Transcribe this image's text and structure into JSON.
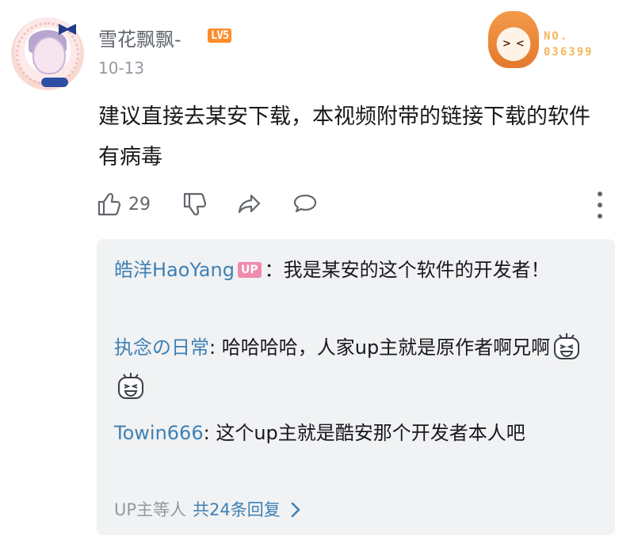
{
  "comment": {
    "username": "雪花飘飘-",
    "level_badge": "LV5",
    "date": "10-13",
    "text": "建议直接去某安下载，本视频附带的链接下载的软件有病毒",
    "like_count": "29"
  },
  "fan_card": {
    "label_no": "NO.",
    "number": "036399"
  },
  "replies": [
    {
      "name": "皓洋HaoYang",
      "badge": "UP",
      "sep": "：",
      "text": "我是某安的这个软件的开发者！"
    },
    {
      "name": "执念の日常",
      "sep": ":",
      "text": "哈哈哈哈，人家up主就是原作者啊兄啊",
      "emote_count": 2
    },
    {
      "name": "Towin666",
      "sep": ":",
      "text": "这个up主就是酷安那个开发者本人吧"
    }
  ],
  "more_replies": {
    "prefix": "UP主等人",
    "link": "共24条回复"
  },
  "icons": [
    "thumbs-up-icon",
    "thumbs-down-icon",
    "share-icon",
    "reply-icon",
    "more-vertical-icon",
    "chevron-right-icon"
  ],
  "colors": {
    "link_blue": "#3e80b5",
    "level_orange": "#ff8c2a",
    "up_badge_pink": "#f08baf",
    "reply_bg": "#f1f2f3"
  }
}
